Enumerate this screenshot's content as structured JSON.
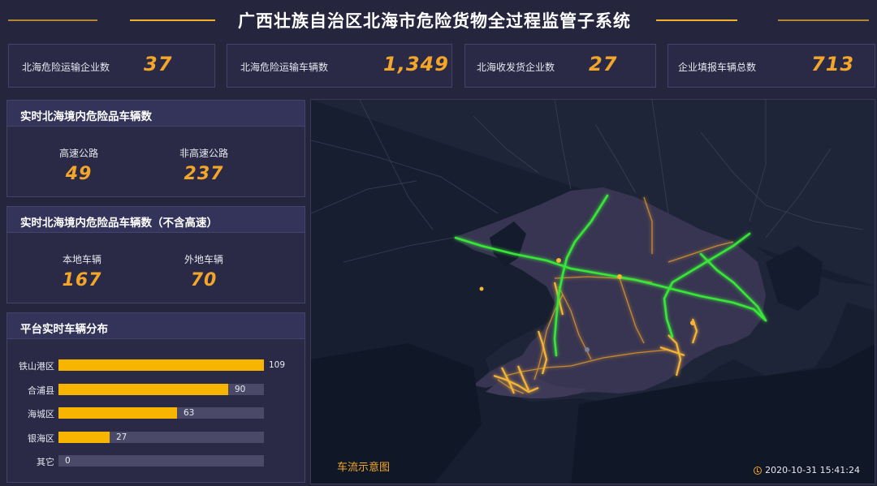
{
  "header": {
    "title": "广西壮族自治区北海市危险货物全过程监管子系统",
    "accent_color": "#f0b12c"
  },
  "stats": [
    {
      "label": "北海危险运输企业数",
      "value": "37"
    },
    {
      "label": "北海危险运输车辆数",
      "value": "1,349"
    },
    {
      "label": "北海收发货企业数",
      "value": "27"
    },
    {
      "label": "企业填报车辆总数",
      "value": "713"
    }
  ],
  "panel_highway": {
    "title": "实时北海境内危险品车辆数",
    "items": [
      {
        "label": "高速公路",
        "value": "49"
      },
      {
        "label": "非高速公路",
        "value": "237"
      }
    ]
  },
  "panel_local": {
    "title": "实时北海境内危险品车辆数（不含高速）",
    "items": [
      {
        "label": "本地车辆",
        "value": "167"
      },
      {
        "label": "外地车辆",
        "value": "70"
      }
    ]
  },
  "panel_distribution": {
    "title": "平台实时车辆分布",
    "bar_color": "#f7b500",
    "chart_data": {
      "type": "bar",
      "orientation": "horizontal",
      "categories": [
        "铁山港区",
        "合浦县",
        "海城区",
        "银海区",
        "其它"
      ],
      "values": [
        109,
        90,
        63,
        27,
        0
      ],
      "xlim": [
        0,
        109
      ]
    }
  },
  "map": {
    "caption": "车流示意图",
    "timestamp": "2020-10-31 15:41:24",
    "highway_color": "#39e639",
    "road_color": "#f3a62a"
  }
}
